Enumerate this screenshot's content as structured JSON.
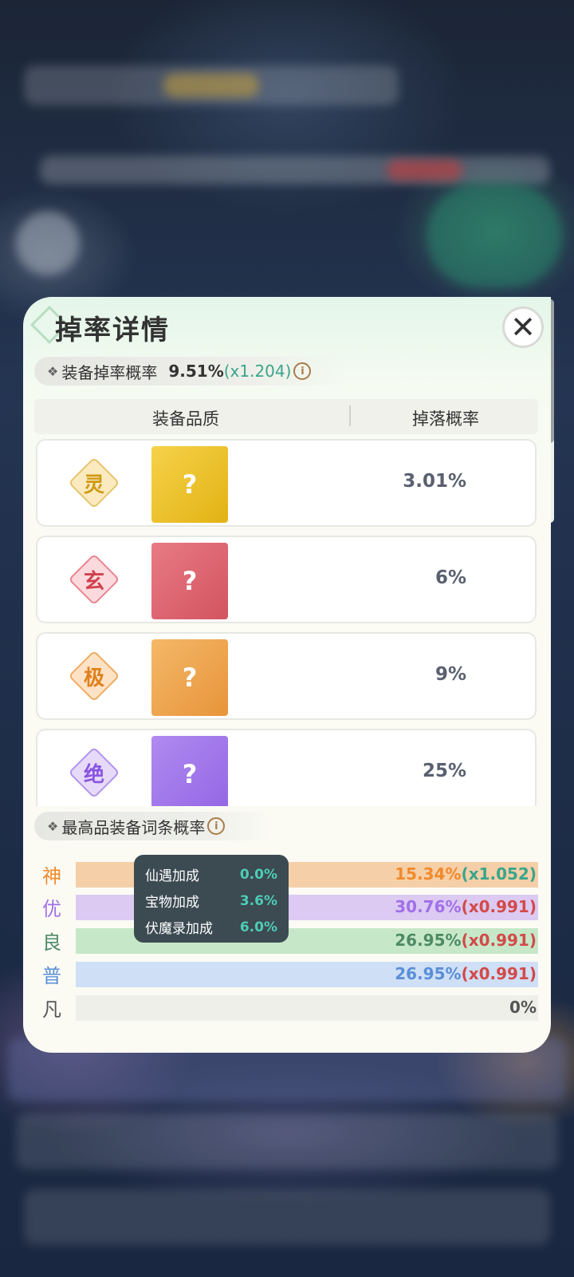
{
  "panel": {
    "title": "掉率详情",
    "close_label": "✕"
  },
  "equip_drop": {
    "label": "装备掉率概率",
    "rate": "9.51%",
    "multiplier": "(x1.204)",
    "info_icon": "info-icon"
  },
  "table": {
    "col_quality": "装备品质",
    "col_rate": "掉落概率",
    "rows": [
      {
        "quality": "灵",
        "icon": "?",
        "rate": "3.01%",
        "color": "#e0b21c"
      },
      {
        "quality": "玄",
        "icon": "?",
        "rate": "6%",
        "color": "#e06070"
      },
      {
        "quality": "极",
        "icon": "?",
        "rate": "9%",
        "color": "#f0a040"
      },
      {
        "quality": "绝",
        "icon": "?",
        "rate": "25%",
        "color": "#a070e8"
      }
    ]
  },
  "affix": {
    "label": "最高品装备词条概率",
    "info_icon": "info-icon",
    "bars": [
      {
        "grade": "神",
        "value": "15.34%",
        "multiplier": "(x1.052)",
        "fraction": 1.0,
        "color": "#f5cfa8",
        "text_color": "#f08a2c",
        "mult_color": "#3aa58a"
      },
      {
        "grade": "优",
        "value": "30.76%",
        "multiplier": "(x0.991)",
        "fraction": 1.0,
        "color": "#dccaf2",
        "text_color": "#a070e8",
        "mult_color": "#d24a4a"
      },
      {
        "grade": "良",
        "value": "26.95%",
        "multiplier": "(x0.991)",
        "fraction": 1.0,
        "color": "#c6e8c9",
        "text_color": "#4e8a66",
        "mult_color": "#d24a4a"
      },
      {
        "grade": "普",
        "value": "26.95%",
        "multiplier": "(x0.991)",
        "fraction": 1.0,
        "color": "#cfdff5",
        "text_color": "#5a8ed8",
        "mult_color": "#d24a4a"
      },
      {
        "grade": "凡",
        "value": "0%",
        "multiplier": "",
        "fraction": 0.0,
        "color": "#efefea",
        "text_color": "#555555",
        "mult_color": "#555555"
      }
    ]
  },
  "tooltip": {
    "lines": [
      {
        "label": "仙遇加成",
        "value": "0.0%"
      },
      {
        "label": "宝物加成",
        "value": "3.6%"
      },
      {
        "label": "伏魔录加成",
        "value": "6.0%"
      }
    ]
  }
}
